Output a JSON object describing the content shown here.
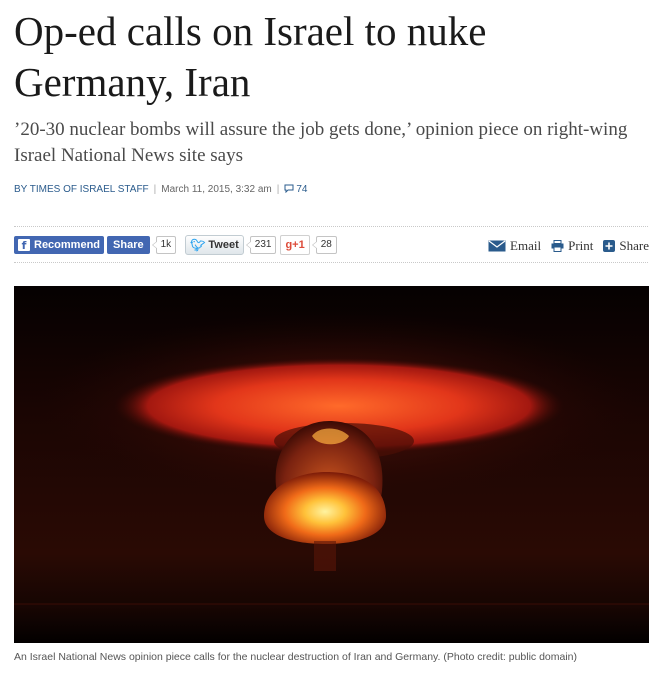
{
  "article": {
    "headline": "Op-ed calls on Israel to nuke Germany, Iran",
    "subhead": "’20-30 nuclear bombs will assure the job gets done,’ opinion piece on right-wing Israel National News site says",
    "byline": "BY TIMES OF ISRAEL STAFF",
    "separator": "|",
    "date": "March 11, 2015, 3:32 am",
    "comment_count": "74"
  },
  "social": {
    "facebook_recommend": "Recommend",
    "facebook_share": "Share",
    "facebook_count": "1k",
    "tweet": "Tweet",
    "tweet_count": "231",
    "gplus": "g+1",
    "gplus_count": "28"
  },
  "tools": {
    "email": "Email",
    "print": "Print",
    "share": "Share"
  },
  "photo": {
    "caption": "An Israel National News opinion piece calls for the nuclear destruction of Iran and Germany. (Photo credit: public domain)"
  },
  "colors": {
    "link_blue": "#2a5b8c",
    "facebook_blue": "#4267b2",
    "twitter_blue": "#2aa3ef",
    "gplus_red": "#dd4b39"
  },
  "icons": {
    "comments": "speech-bubble-icon",
    "facebook": "facebook-f-icon",
    "twitter": "twitter-bird-icon",
    "email": "envelope-icon",
    "print": "printer-icon",
    "share": "plus-box-icon"
  }
}
